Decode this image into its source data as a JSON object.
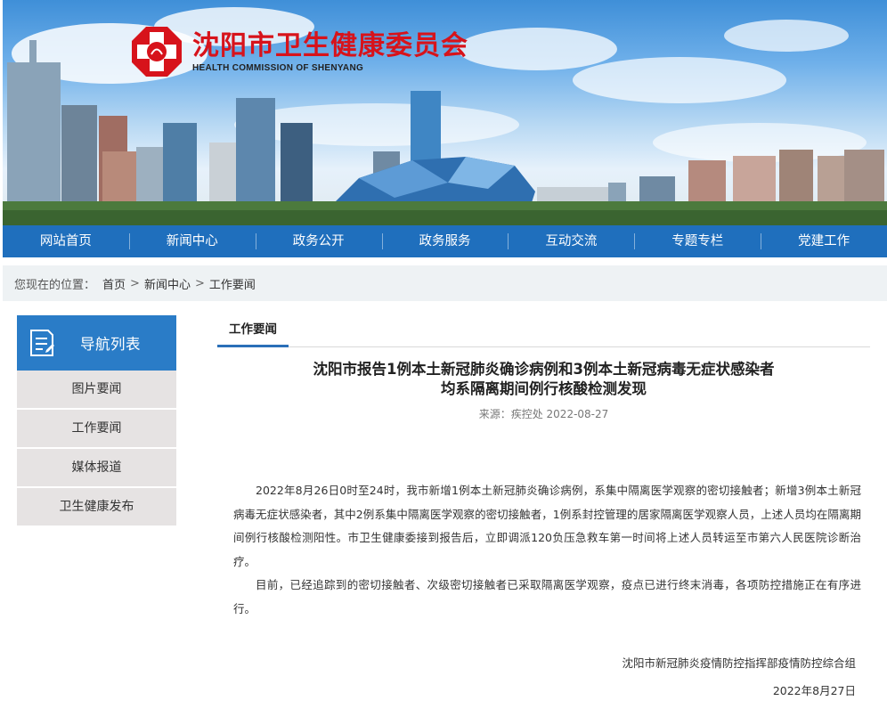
{
  "site": {
    "name_cn": "沈阳市卫生健康委员会",
    "name_en": "HEALTH COMMISSION OF SHENYANG",
    "brand_color": "#d7131b"
  },
  "nav": {
    "items": [
      "网站首页",
      "新闻中心",
      "政务公开",
      "政务服务",
      "互动交流",
      "专题专栏",
      "党建工作"
    ],
    "color": "#1f6fbd"
  },
  "breadcrumb": {
    "prefix": "您现在的位置：",
    "items": [
      "首页",
      "新闻中心",
      "工作要闻"
    ],
    "separator": ">"
  },
  "sidebar": {
    "title": "导航列表",
    "icon": "document-list-icon",
    "items": [
      "图片要闻",
      "工作要闻",
      "媒体报道",
      "卫生健康发布"
    ]
  },
  "main": {
    "tab": "工作要闻",
    "title_line1": "沈阳市报告1例本土新冠肺炎确诊病例和3例本土新冠病毒无症状感染者",
    "title_line2": "均系隔离期间例行核酸检测发现",
    "meta": "来源：疾控处 2022-08-27",
    "paragraphs": [
      "2022年8月26日0时至24时，我市新增1例本土新冠肺炎确诊病例，系集中隔离医学观察的密切接触者；新增3例本土新冠病毒无症状感染者，其中2例系集中隔离医学观察的密切接触者，1例系封控管理的居家隔离医学观察人员，上述人员均在隔离期间例行核酸检测阳性。市卫生健康委接到报告后，立即调派120负压急救车第一时间将上述人员转运至市第六人民医院诊断治疗。",
      "目前，已经追踪到的密切接触者、次级密切接触者已采取隔离医学观察，疫点已进行终末消毒，各项防控措施正在有序进行。"
    ],
    "signature_org": "沈阳市新冠肺炎疫情防控指挥部疫情防控综合组",
    "signature_date": "2022年8月27日"
  }
}
